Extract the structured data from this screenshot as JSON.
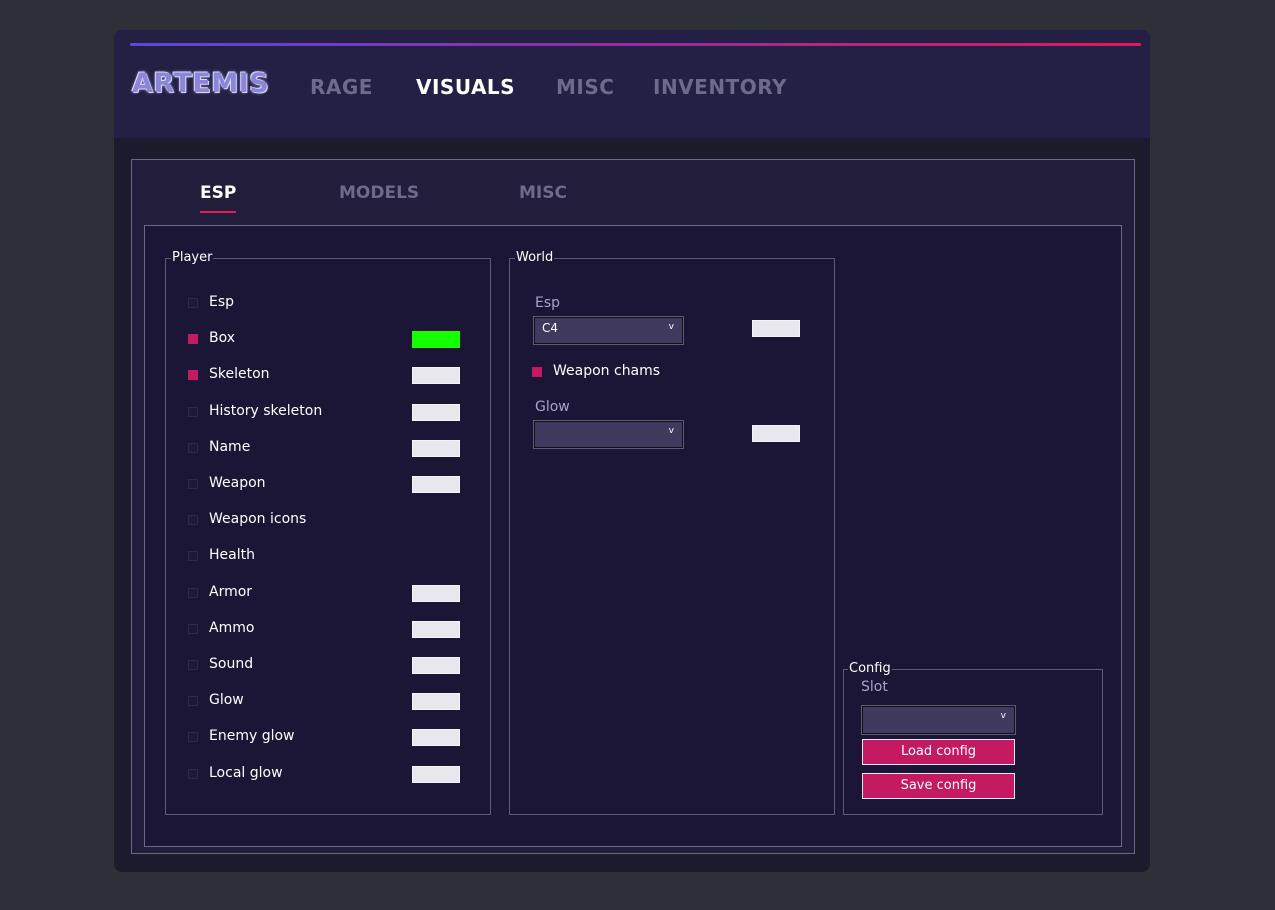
{
  "app": {
    "logo": "ARTEMIS",
    "main_tabs": [
      "RAGE",
      "VISUALS",
      "MISC",
      "INVENTORY"
    ],
    "active_main_tab": "VISUALS"
  },
  "sub_tabs": [
    "ESP",
    "MODELS",
    "MISC"
  ],
  "active_sub_tab": "ESP",
  "player": {
    "title": "Player",
    "items": [
      {
        "label": "Esp",
        "checked": false,
        "color": null
      },
      {
        "label": "Box",
        "checked": true,
        "color": "#14ff00"
      },
      {
        "label": "Skeleton",
        "checked": true,
        "color": "#e8e7ee"
      },
      {
        "label": "History skeleton",
        "checked": false,
        "color": "#e8e7ee"
      },
      {
        "label": "Name",
        "checked": false,
        "color": "#e8e7ee"
      },
      {
        "label": "Weapon",
        "checked": false,
        "color": "#e8e7ee"
      },
      {
        "label": "Weapon icons",
        "checked": false,
        "color": null
      },
      {
        "label": "Health",
        "checked": false,
        "color": null
      },
      {
        "label": "Armor",
        "checked": false,
        "color": "#e8e7ee"
      },
      {
        "label": "Ammo",
        "checked": false,
        "color": "#e8e7ee"
      },
      {
        "label": "Sound",
        "checked": false,
        "color": "#e8e7ee"
      },
      {
        "label": "Glow",
        "checked": false,
        "color": "#e8e7ee"
      },
      {
        "label": "Enemy glow",
        "checked": false,
        "color": "#e8e7ee"
      },
      {
        "label": "Local glow",
        "checked": false,
        "color": "#e8e7ee"
      }
    ]
  },
  "world": {
    "title": "World",
    "esp_label": "Esp",
    "esp_value": "C4",
    "weapon_chams_label": "Weapon chams",
    "weapon_chams_checked": true,
    "glow_label": "Glow",
    "glow_value": ""
  },
  "config": {
    "title": "Config",
    "slot_label": "Slot",
    "slot_value": "",
    "load_label": "Load config",
    "save_label": "Save config"
  },
  "colors": {
    "accent": "#e11a58",
    "checkbox_on": "#c41a62",
    "swatch_default": "#e8e7ee",
    "swatch_box": "#14ff00"
  }
}
